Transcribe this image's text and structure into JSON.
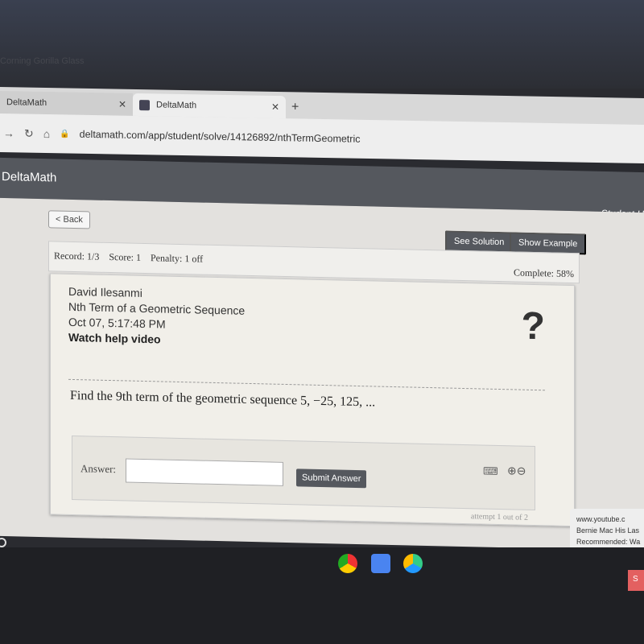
{
  "bezel": {
    "text": "Corning Gorilla Glass"
  },
  "browser": {
    "tabs": [
      {
        "label": "DeltaMath",
        "active": false
      },
      {
        "label": "DeltaMath",
        "active": true
      }
    ],
    "url": "deltamath.com/app/student/solve/14126892/nthTermGeometric"
  },
  "app": {
    "title": "DeltaMath",
    "user_menu": "Student H"
  },
  "toolbar": {
    "back": "< Back",
    "see_solution": "See Solution",
    "show_example": "Show Example"
  },
  "record": {
    "record": "Record: 1/3",
    "score": "Score: 1",
    "penalty": "Penalty: 1 off",
    "complete": "Complete: 58%"
  },
  "problem": {
    "student": "David Ilesanmi",
    "topic": "Nth Term of a Geometric Sequence",
    "timestamp": "Oct 07, 5:17:48 PM",
    "help": "Watch help video",
    "help_icon": "?",
    "question": "Find the 9th term of the geometric sequence 5, −25, 125, ..."
  },
  "answer": {
    "label": "Answer:",
    "value": "",
    "submit": "Submit Answer",
    "attempt": "attempt 1 out of 2"
  },
  "notification": {
    "source": "www.youtube.c",
    "title": "Bernie Mac His Las",
    "subtitle": "Recommended: Wa"
  },
  "shelf": {
    "button": "S"
  }
}
